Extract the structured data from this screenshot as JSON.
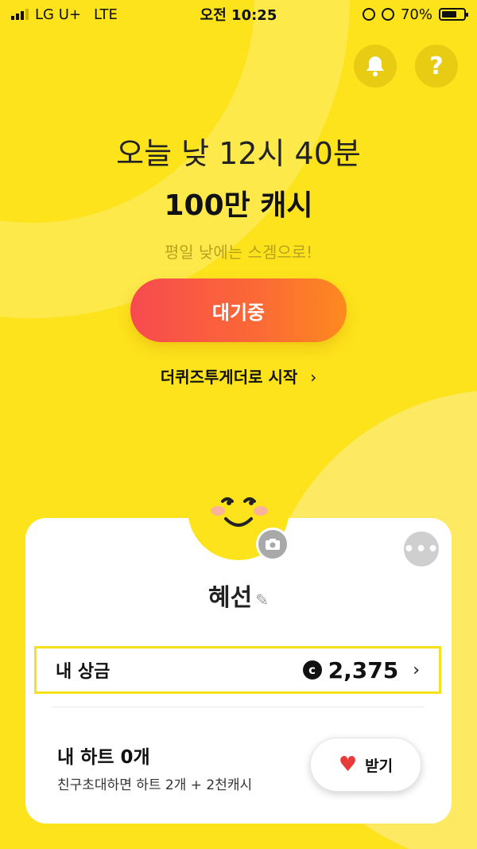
{
  "status_bar": {
    "carrier": "LG U+",
    "network": "LTE",
    "time": "오전 10:25",
    "battery": "70%",
    "battery_level": 0.7
  },
  "header_buttons": {
    "bell_icon": "bell-icon",
    "help_label": "?"
  },
  "headline": {
    "line1": "오늘 낮 12시 40분",
    "line2": "100만 캐시",
    "line3": "평일 낮에는 스겜으로!"
  },
  "wait_button": {
    "label": "대기중"
  },
  "start_link": {
    "label": "더퀴즈투게더로 시작",
    "chevron": "›"
  },
  "profile": {
    "name": "혜선",
    "more_label": "•••"
  },
  "prize": {
    "label": "내 상금",
    "coin_symbol": "c",
    "amount": "2,375",
    "chevron": "›"
  },
  "hearts": {
    "title": "내 하트 0개",
    "subtitle": "친구초대하면 하트 2개 + 2천캐시",
    "button_label": "받기"
  },
  "colors": {
    "background": "#fde31c",
    "accent_gradient_start": "#f84a4f",
    "accent_gradient_end": "#fd8a1f",
    "highlight_border": "#f5e21a"
  }
}
